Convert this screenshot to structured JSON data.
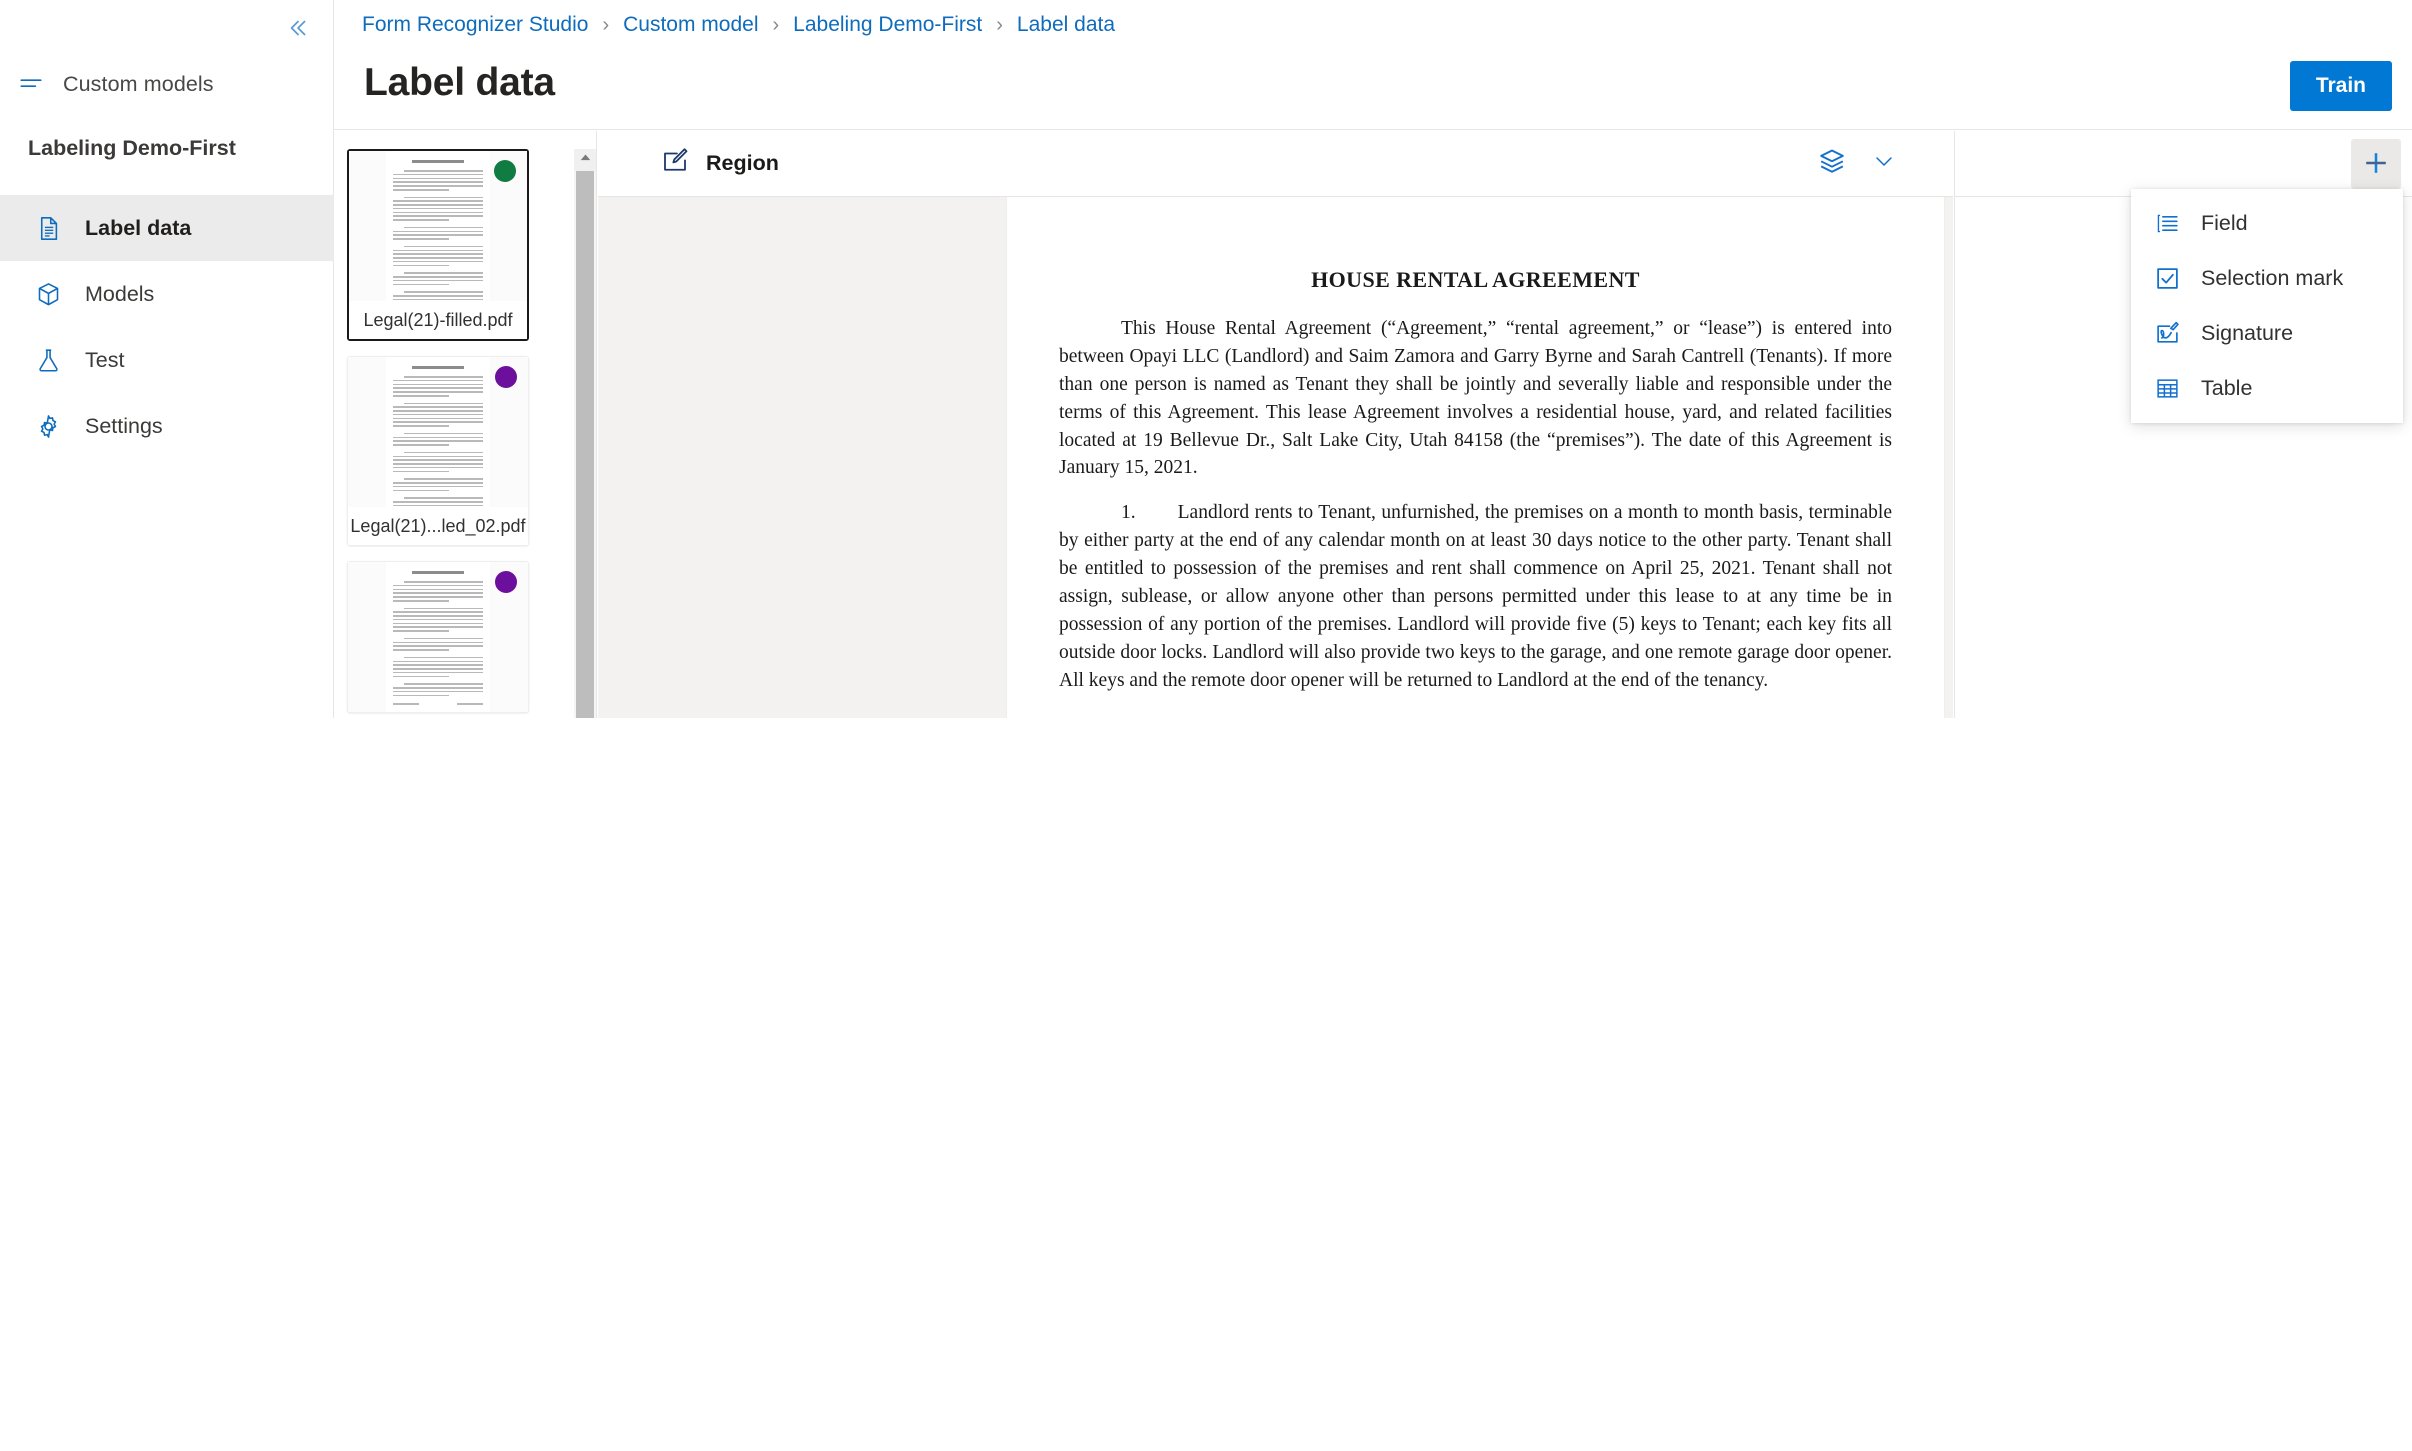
{
  "sidebar": {
    "collapse_icon": "chevron-double-left-icon",
    "custom_models": {
      "label": "Custom models",
      "icon": "menu-lines-icon"
    },
    "project_title": "Labeling Demo-First",
    "items": [
      {
        "label": "Label data",
        "icon": "document-icon",
        "active": true
      },
      {
        "label": "Models",
        "icon": "package-icon",
        "active": false
      },
      {
        "label": "Test",
        "icon": "flask-icon",
        "active": false
      },
      {
        "label": "Settings",
        "icon": "gear-icon",
        "active": false
      }
    ]
  },
  "breadcrumb": {
    "separator": "›",
    "items": [
      {
        "label": "Form Recognizer Studio"
      },
      {
        "label": "Custom model"
      },
      {
        "label": "Labeling Demo-First"
      },
      {
        "label": "Label data"
      }
    ]
  },
  "header": {
    "title": "Label data",
    "train_button": "Train"
  },
  "file_list": {
    "scroll_up_icon": "caret-up-icon",
    "files": [
      {
        "name": "Legal(21)-filled.pdf",
        "dot_color": "#107c41",
        "selected": true
      },
      {
        "name": "Legal(21)...led_02.pdf",
        "dot_color": "#6b0f9c",
        "selected": false
      },
      {
        "name": "",
        "dot_color": "#6b0f9c",
        "selected": false
      }
    ]
  },
  "viewer": {
    "toolbar": {
      "region_label": "Region",
      "region_icon": "region-draw-icon",
      "layers_icon": "layers-icon",
      "chevron_icon": "chevron-down-icon"
    },
    "document": {
      "title": "HOUSE RENTAL AGREEMENT",
      "paragraph_1": "This House Rental Agreement (“Agreement,” “rental agreement,” or “lease”) is entered into between Opayi LLC (Landlord) and Saim Zamora and Garry Byrne and Sarah Cantrell (Tenants).   If more than one person is named as Tenant they shall be jointly and severally liable and responsible under the terms of this Agreement.  This lease Agreement involves a residential house, yard, and related facilities located at 19 Bellevue Dr., Salt Lake City, Utah 84158 (the “premises”). The date of this Agreement is January 15, 2021.",
      "clause_1_number": "1.",
      "clause_1_text": "Landlord rents to Tenant, unfurnished, the premises on a month to month basis, terminable by either party at the end of any calendar month on at least 30 days notice to the other party.  Tenant shall be entitled to possession of the premises and rent shall commence on April 25, 2021.  Tenant shall not assign, sublease, or allow anyone other than persons permitted under this lease to at any time be in possession of any portion of the premises.  Landlord will provide five (5) keys to Tenant; each key fits all outside door locks.  Landlord will also provide two keys to the garage, and one remote garage door opener.  All keys and the remote door opener will be returned to Landlord at the end of the tenancy."
    }
  },
  "label_panel": {
    "add_icon": "plus-icon"
  },
  "menu": {
    "items": [
      {
        "label": "Field",
        "icon": "field-list-icon"
      },
      {
        "label": "Selection mark",
        "icon": "checkbox-icon"
      },
      {
        "label": "Signature",
        "icon": "signature-icon"
      },
      {
        "label": "Table",
        "icon": "table-grid-icon"
      }
    ]
  },
  "colors": {
    "accent": "#0078d4",
    "link": "#0f6cbd",
    "icon_blue": "#0f6cbd",
    "selected_row": "#ebebeb",
    "canvas_bg": "#f3f2f1"
  }
}
